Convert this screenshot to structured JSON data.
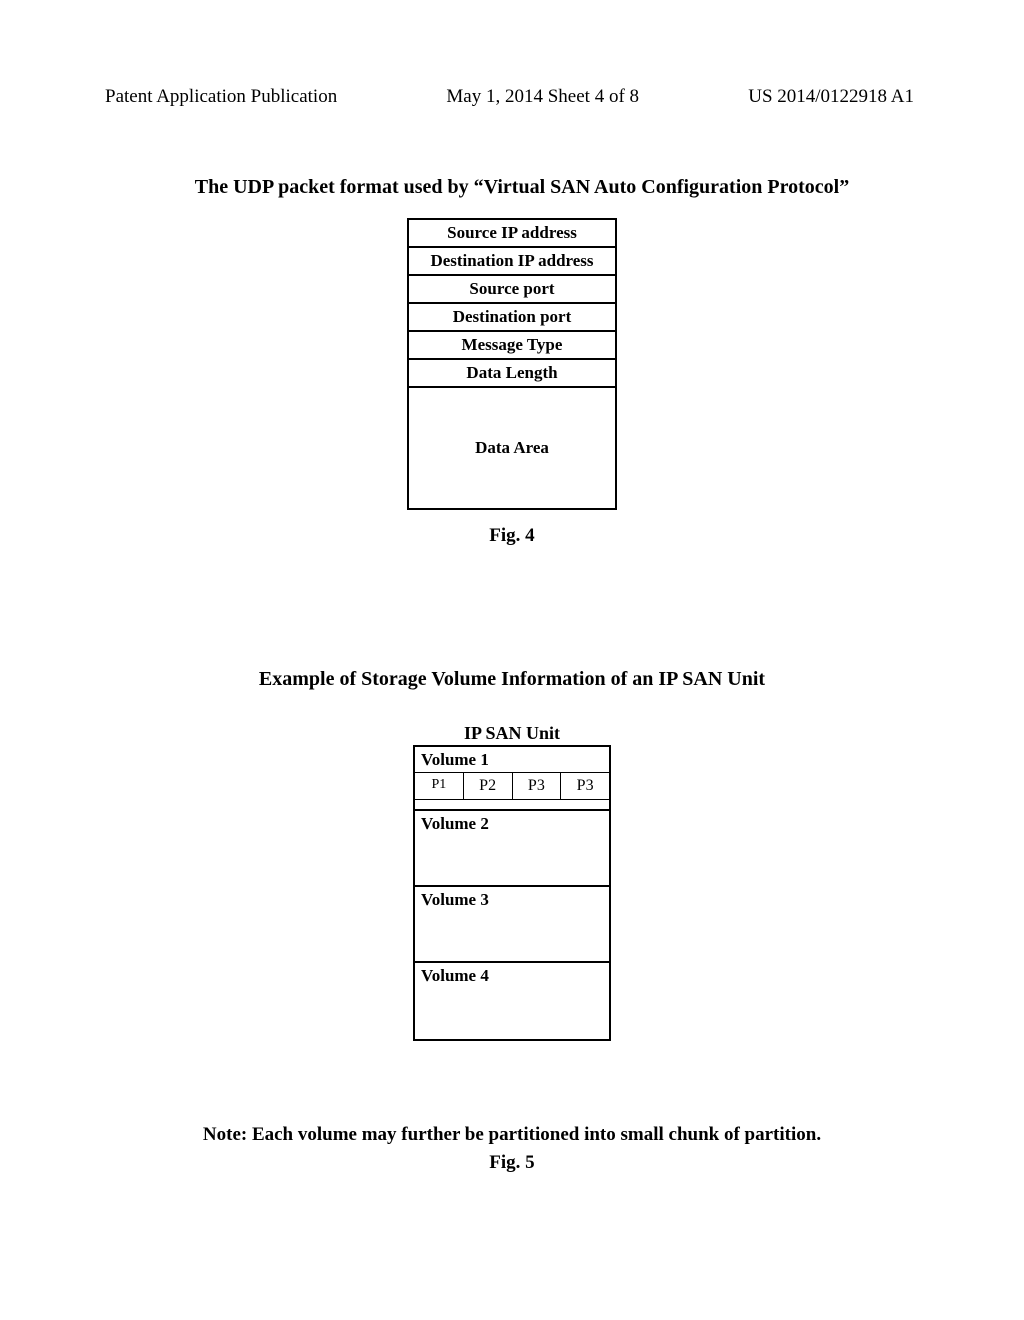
{
  "header": {
    "left": "Patent Application Publication",
    "center": "May 1, 2014   Sheet 4 of 8",
    "right": "US 2014/0122918 A1"
  },
  "fig4": {
    "title": "The UDP packet format used by “Virtual SAN Auto Configuration Protocol”",
    "rows": [
      "Source IP address",
      "Destination IP address",
      "Source port",
      "Destination port",
      "Message Type",
      "Data Length",
      "Data Area"
    ],
    "caption": "Fig. 4"
  },
  "fig5": {
    "title": "Example of Storage Volume Information of an IP SAN Unit",
    "unit_label": "IP SAN Unit",
    "volume1": {
      "label": "Volume 1",
      "partitions": [
        "P1",
        "P2",
        "P3",
        "P3"
      ]
    },
    "volume2": {
      "label": "Volume 2"
    },
    "volume3": {
      "label": "Volume 3"
    },
    "volume4": {
      "label": "Volume 4"
    },
    "note": "Note: Each volume may further be partitioned into small chunk of partition.",
    "caption": "Fig. 5"
  }
}
